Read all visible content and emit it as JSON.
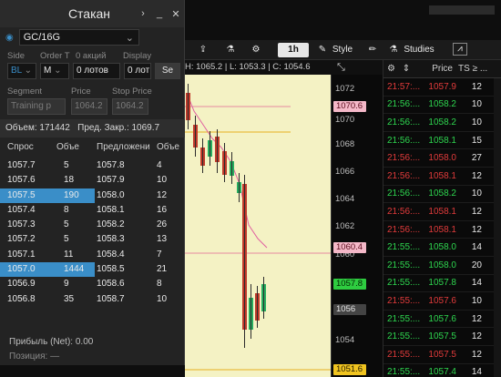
{
  "dom_panel": {
    "title": "Стакан",
    "symbol": "GC/16G",
    "labels": {
      "side": "Side",
      "order_type": "Order T",
      "shares": "0 акций",
      "display": "Display",
      "segment": "Segment",
      "price": "Price",
      "stop_price": "Stop Price"
    },
    "side_value": "BL",
    "order_type_value": "M",
    "lots_value": "0 лотов",
    "display_value": "0 лот",
    "send_label": "Se",
    "segment_value": "Training p",
    "price_value": "1064.2",
    "stop_price_value": "1064.2",
    "volume_label": "Объем:",
    "volume_value": "171442",
    "prev_close_label": "Пред. Закр.:",
    "prev_close_value": "1069.7",
    "book_headers": [
      "Спрос",
      "Объе",
      "Предложени",
      "Объе"
    ],
    "book_rows": [
      {
        "bid": "1057.7",
        "bid_size": "5",
        "ask": "1057.8",
        "ask_size": "4"
      },
      {
        "bid": "1057.6",
        "bid_size": "18",
        "ask": "1057.9",
        "ask_size": "10"
      },
      {
        "bid": "1057.5",
        "bid_size": "190",
        "ask": "1058.0",
        "ask_size": "12"
      },
      {
        "bid": "1057.4",
        "bid_size": "8",
        "ask": "1058.1",
        "ask_size": "16"
      },
      {
        "bid": "1057.3",
        "bid_size": "5",
        "ask": "1058.2",
        "ask_size": "26"
      },
      {
        "bid": "1057.2",
        "bid_size": "5",
        "ask": "1058.3",
        "ask_size": "13"
      },
      {
        "bid": "1057.1",
        "bid_size": "11",
        "ask": "1058.4",
        "ask_size": "7"
      },
      {
        "bid": "1057.0",
        "bid_size": "1444",
        "ask": "1058.5",
        "ask_size": "21"
      },
      {
        "bid": "1056.9",
        "bid_size": "9",
        "ask": "1058.6",
        "ask_size": "8"
      },
      {
        "bid": "1056.8",
        "bid_size": "35",
        "ask": "1058.7",
        "ask_size": "10"
      }
    ],
    "pnl_label": "Прибыль (Net):",
    "pnl_value": "0.00",
    "position_label": "Позиция:",
    "position_value": "—",
    "highlight_color": "#3a8ec8"
  },
  "chart": {
    "timeframe": "1h",
    "style_label": "Style",
    "studies_label": "Studies",
    "ohlc_text": "H: 1065.2 | L: 1053.3 | C: 1054.6",
    "axis_ticks": [
      "1072",
      "1070",
      "1068",
      "1066",
      "1064",
      "1062",
      "1060",
      "1058",
      "1056",
      "1054"
    ],
    "badges": [
      {
        "value": "1070.6",
        "bg": "#f4b8c8",
        "fg": "#5a0a1a"
      },
      {
        "value": "1060.4",
        "bg": "#f4b8c8",
        "fg": "#5a0a1a"
      },
      {
        "value": "1057.8",
        "bg": "#2ecc40",
        "fg": "#002200"
      },
      {
        "value": "1056",
        "bg": "#444444",
        "fg": "#e8e8e8"
      },
      {
        "value": "1051.6",
        "bg": "#f0c420",
        "fg": "#221a00"
      }
    ],
    "background": "#f4f2c4"
  },
  "time_sales": {
    "headers": [
      "Price",
      "TS ≥ ..."
    ],
    "rows": [
      {
        "time": "21:57:...",
        "price": "1057.9",
        "size": "12",
        "dir": "dn"
      },
      {
        "time": "21:56:...",
        "price": "1058.2",
        "size": "10",
        "dir": "up"
      },
      {
        "time": "21:56:...",
        "price": "1058.2",
        "size": "10",
        "dir": "up"
      },
      {
        "time": "21:56:...",
        "price": "1058.1",
        "size": "15",
        "dir": "up"
      },
      {
        "time": "21:56:...",
        "price": "1058.0",
        "size": "27",
        "dir": "dn"
      },
      {
        "time": "21:56:...",
        "price": "1058.1",
        "size": "12",
        "dir": "dn"
      },
      {
        "time": "21:56:...",
        "price": "1058.2",
        "size": "10",
        "dir": "up"
      },
      {
        "time": "21:56:...",
        "price": "1058.1",
        "size": "12",
        "dir": "dn"
      },
      {
        "time": "21:56:...",
        "price": "1058.1",
        "size": "12",
        "dir": "dn"
      },
      {
        "time": "21:55:...",
        "price": "1058.0",
        "size": "14",
        "dir": "up"
      },
      {
        "time": "21:55:...",
        "price": "1058.0",
        "size": "20",
        "dir": "up"
      },
      {
        "time": "21:55:...",
        "price": "1057.8",
        "size": "14",
        "dir": "up"
      },
      {
        "time": "21:55:...",
        "price": "1057.6",
        "size": "10",
        "dir": "dn"
      },
      {
        "time": "21:55:...",
        "price": "1057.6",
        "size": "12",
        "dir": "up"
      },
      {
        "time": "21:55:...",
        "price": "1057.5",
        "size": "12",
        "dir": "up"
      },
      {
        "time": "21:55:...",
        "price": "1057.5",
        "size": "12",
        "dir": "dn"
      },
      {
        "time": "21:55:...",
        "price": "1057.4",
        "size": "14",
        "dir": "up"
      }
    ]
  }
}
